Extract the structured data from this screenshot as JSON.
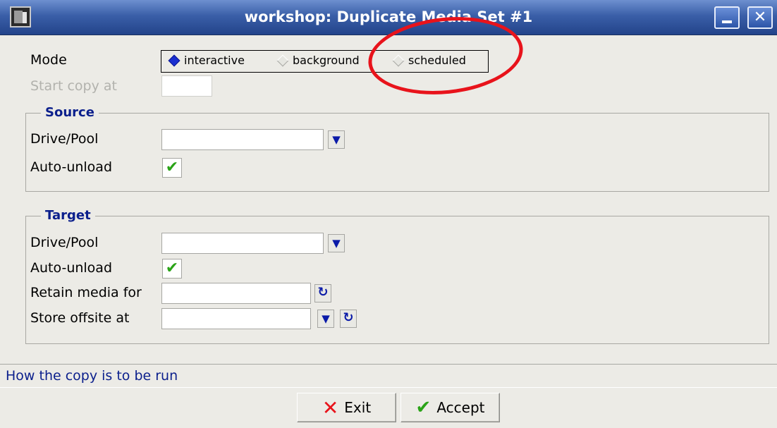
{
  "window": {
    "title": "workshop: Duplicate Media Set #1",
    "minimize_glyph": "_",
    "close_glyph": "✕"
  },
  "mode": {
    "label": "Mode",
    "options": [
      "interactive",
      "background",
      "scheduled"
    ],
    "selected": "interactive"
  },
  "start_copy": {
    "label": "Start copy at",
    "value": ""
  },
  "source": {
    "title": "Source",
    "drive_pool_label": "Drive/Pool",
    "drive_pool_value": "",
    "auto_unload_label": "Auto-unload",
    "auto_unload_checked": "✔"
  },
  "target": {
    "title": "Target",
    "drive_pool_label": "Drive/Pool",
    "drive_pool_value": "",
    "auto_unload_label": "Auto-unload",
    "auto_unload_checked": "✔",
    "retain_label": "Retain media for",
    "retain_value": "",
    "offsite_label": "Store offsite at",
    "offsite_value": ""
  },
  "icons": {
    "dropdown": "▼",
    "refresh": "↻"
  },
  "status": {
    "text": "How the copy is to be run"
  },
  "buttons": {
    "exit": {
      "glyph": "✕",
      "label": "Exit"
    },
    "accept": {
      "glyph": "✔",
      "label": "Accept"
    }
  },
  "colors": {
    "annotation": "#e8131b",
    "title_bar": "#3a5fa8",
    "group_title": "#0b1f8c"
  }
}
